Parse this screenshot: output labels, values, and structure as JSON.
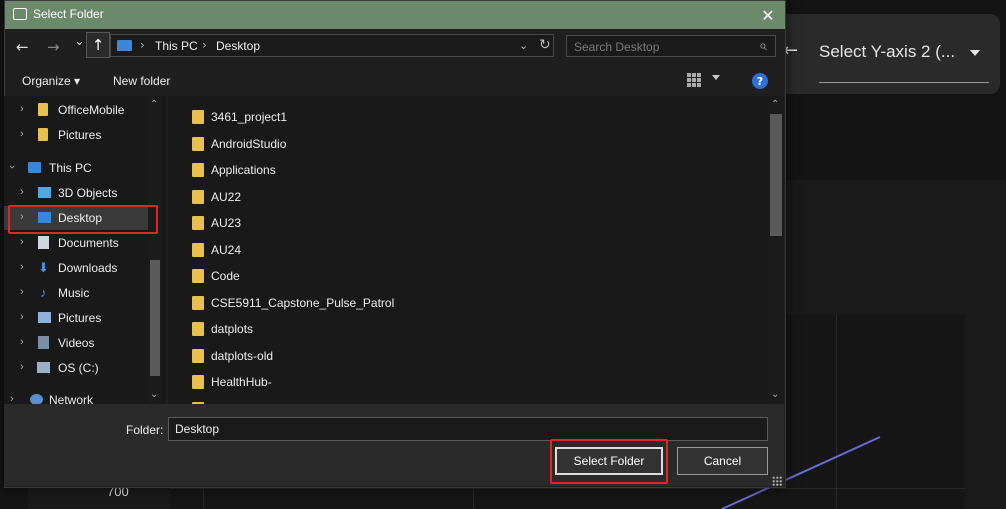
{
  "background": {
    "back_arrow": "←",
    "select_label": "Select Y-axis 2 (...",
    "y_tick": "700"
  },
  "dialog": {
    "title": "Select Folder",
    "close": "✕",
    "nav": {
      "back": "←",
      "forward": "→",
      "recent": "⌄",
      "up": "↑"
    },
    "address": {
      "segments": [
        "This PC",
        "Desktop"
      ],
      "separator": "›",
      "dropdown": "⌄",
      "refresh": "↻"
    },
    "search": {
      "placeholder": "Search Desktop",
      "icon": "⌕"
    },
    "toolbar": {
      "organize": "Organize ▾",
      "new_folder": "New folder",
      "help": "?"
    },
    "navpane": {
      "items": [
        {
          "label": "OfficeMobile",
          "icon": "folder-icon"
        },
        {
          "label": "Pictures",
          "icon": "folder-icon"
        },
        {
          "label": "This PC",
          "icon": "pc-icon"
        },
        {
          "label": "3D Objects",
          "icon": "3d-objects-icon"
        },
        {
          "label": "Desktop",
          "icon": "desktop-icon"
        },
        {
          "label": "Documents",
          "icon": "documents-icon"
        },
        {
          "label": "Downloads",
          "icon": "downloads-icon"
        },
        {
          "label": "Music",
          "icon": "music-icon"
        },
        {
          "label": "Pictures",
          "icon": "pictures-icon"
        },
        {
          "label": "Videos",
          "icon": "videos-icon"
        },
        {
          "label": "OS (C:)",
          "icon": "drive-icon"
        },
        {
          "label": "Network",
          "icon": "network-icon"
        }
      ]
    },
    "files": [
      "3461_project1",
      "AndroidStudio",
      "Applications",
      "AU22",
      "AU23",
      "AU24",
      "Code",
      "CSE5911_Capstone_Pulse_Patrol",
      "datplots",
      "datplots-old",
      "HealthHub-"
    ],
    "folder_label": "Folder:",
    "folder_value": "Desktop",
    "select_button": "Select Folder",
    "cancel_button": "Cancel",
    "colors": {
      "titlebar": "#6b8a6b",
      "highlight": "#e0262b",
      "folder": "#e8c050"
    }
  }
}
